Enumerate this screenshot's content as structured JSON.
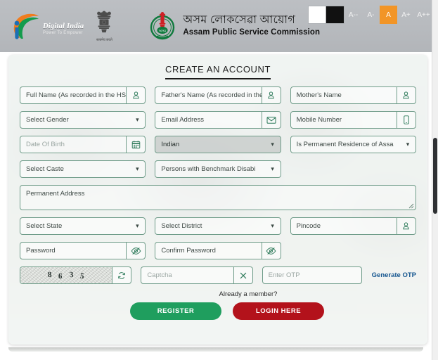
{
  "header": {
    "digital_india": {
      "title": "Digital India",
      "subtitle": "Power To Empower"
    },
    "emblem_caption": "सत्यमेव जयते",
    "org": {
      "name_assamese": "অসম লোকসেৱা আয়োগ",
      "name_english": "Assam Public Service Commission"
    },
    "accessibility": {
      "swatches": [
        {
          "name": "white-contrast-swatch",
          "color": "#ffffff"
        },
        {
          "name": "black-contrast-swatch",
          "color": "#111111"
        }
      ],
      "font_buttons": [
        {
          "label": "A--",
          "active": false
        },
        {
          "label": "A-",
          "active": false
        },
        {
          "label": "A",
          "active": true
        },
        {
          "label": "A+",
          "active": false
        },
        {
          "label": "A++",
          "active": false
        }
      ],
      "active_color": "#f29527"
    }
  },
  "card": {
    "title": "CREATE AN ACCOUNT",
    "fields": {
      "full_name": {
        "placeholder": "Full Name (As recorded in the HSLC",
        "icon": "user-icon"
      },
      "father_name": {
        "placeholder": "Father's Name (As recorded in the H",
        "icon": "user-icon"
      },
      "mother_name": {
        "placeholder": "Mother's Name",
        "icon": "user-icon"
      },
      "gender": {
        "value": "Select Gender"
      },
      "email": {
        "placeholder": "Email Address",
        "icon": "envelope-icon"
      },
      "mobile": {
        "placeholder": "Mobile Number",
        "icon": "mobile-icon"
      },
      "dob": {
        "placeholder": "Date Of Birth",
        "icon": "calendar-icon"
      },
      "nationality": {
        "value": "Indian"
      },
      "permanent_residence": {
        "value": "Is Permanent Residence of Assa"
      },
      "caste": {
        "value": "Select Caste"
      },
      "disability": {
        "value": "Persons with Benchmark Disabi"
      },
      "permanent_address": {
        "placeholder": "Permanent Address"
      },
      "state": {
        "value": "Select State"
      },
      "district": {
        "value": "Select District"
      },
      "pincode": {
        "placeholder": "Pincode",
        "icon": "user-icon"
      },
      "password": {
        "placeholder": "Password",
        "icon": "eye-slash-icon"
      },
      "confirm_password": {
        "placeholder": "Confirm Password",
        "icon": "eye-slash-icon"
      },
      "captcha_image": {
        "characters": [
          "8",
          "6",
          "3",
          "5"
        ],
        "text": "8635",
        "icon": "refresh-icon"
      },
      "captcha_input": {
        "placeholder": "Captcha",
        "icon": "close-x-icon"
      },
      "otp_input": {
        "placeholder": "Enter OTP"
      }
    },
    "generate_otp_link": "Generate OTP",
    "member_note": "Already a member?",
    "buttons": {
      "register": "REGISTER",
      "login": "LOGIN HERE"
    }
  },
  "colors": {
    "register_green": "#1f9e5e",
    "login_red": "#b3121b",
    "link_blue": "#14558f",
    "field_border": "#6f9c89",
    "header_grey": "#b7babe"
  }
}
